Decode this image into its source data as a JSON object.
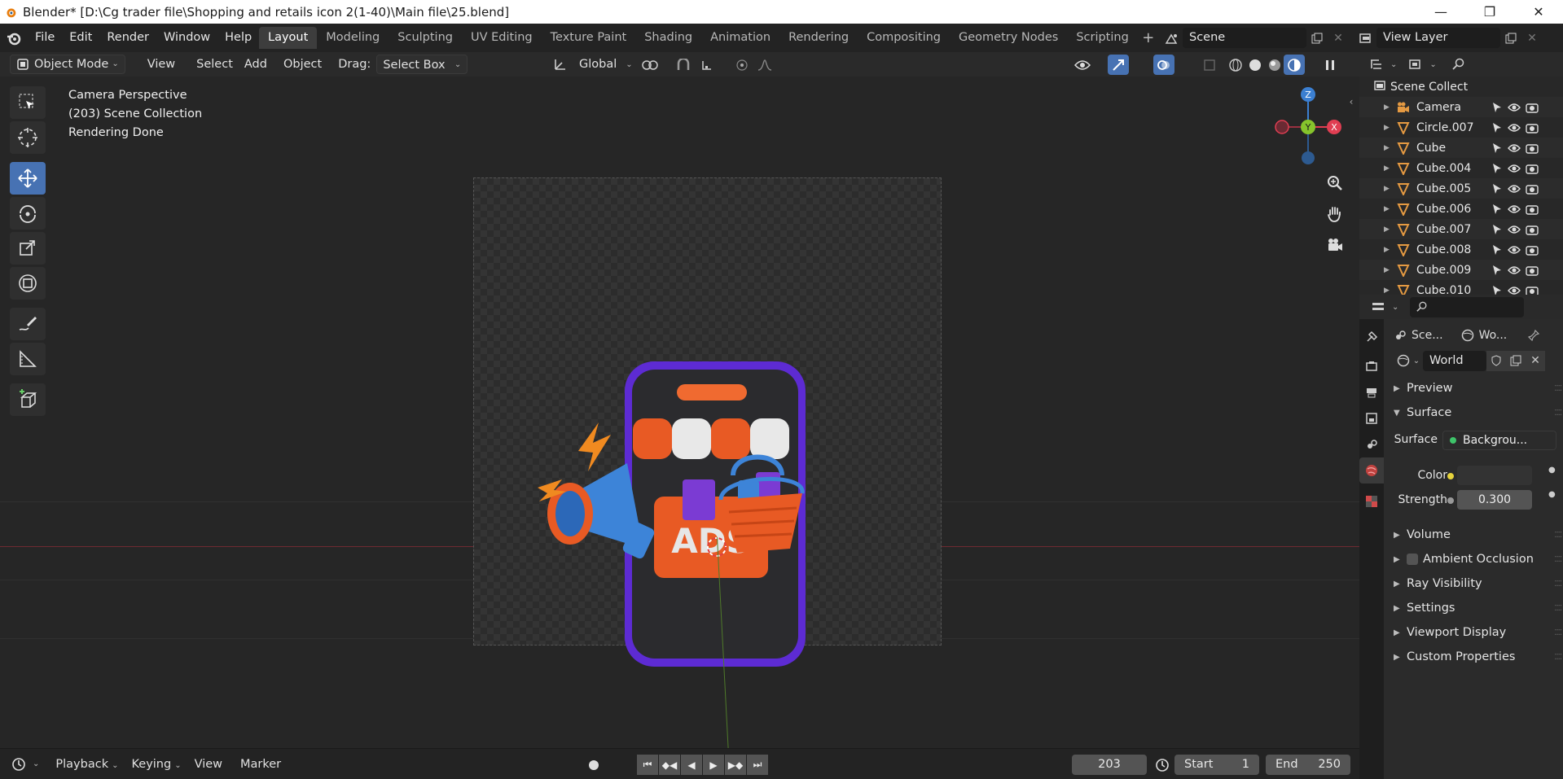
{
  "window": {
    "title": "Blender* [D:\\Cg trader file\\Shopping and retails icon 2(1-40)\\Main file\\25.blend]",
    "minimize": "—",
    "maximize": "❐",
    "close": "✕"
  },
  "menu": {
    "items": [
      "File",
      "Edit",
      "Render",
      "Window",
      "Help"
    ]
  },
  "workspaces": {
    "tabs": [
      "Layout",
      "Modeling",
      "Sculpting",
      "UV Editing",
      "Texture Paint",
      "Shading",
      "Animation",
      "Rendering",
      "Compositing",
      "Geometry Nodes",
      "Scripting"
    ],
    "active": "Layout",
    "add": "+"
  },
  "scene": {
    "name": "Scene"
  },
  "view_layer": {
    "name": "View Layer"
  },
  "viewport_header": {
    "mode": "Object Mode",
    "view": "View",
    "select": "Select",
    "add": "Add",
    "object": "Object",
    "drag_label": "Drag:",
    "drag_value": "Select Box",
    "transform_orientation": "Global"
  },
  "viewport_info": {
    "line1": "Camera Perspective",
    "line2": "(203) Scene Collection",
    "line3": "Rendering Done"
  },
  "gizmo": {
    "z": "Z",
    "y": "Y",
    "x": "X"
  },
  "render_text": {
    "ads": "ADS"
  },
  "outliner": {
    "root": "Scene Collect",
    "items": [
      {
        "name": "Camera",
        "type": "camera"
      },
      {
        "name": "Circle.007",
        "type": "mesh"
      },
      {
        "name": "Cube",
        "type": "mesh"
      },
      {
        "name": "Cube.004",
        "type": "mesh"
      },
      {
        "name": "Cube.005",
        "type": "mesh"
      },
      {
        "name": "Cube.006",
        "type": "mesh"
      },
      {
        "name": "Cube.007",
        "type": "mesh"
      },
      {
        "name": "Cube.008",
        "type": "mesh"
      },
      {
        "name": "Cube.009",
        "type": "mesh"
      },
      {
        "name": "Cube.010",
        "type": "mesh"
      }
    ]
  },
  "properties": {
    "path_scene": "Sce...",
    "path_world": "Wo...",
    "world_name": "World",
    "panels": {
      "preview": "Preview",
      "surface": "Surface",
      "volume": "Volume",
      "ambient_occlusion": "Ambient Occlusion",
      "ray_visibility": "Ray Visibility",
      "settings": "Settings",
      "viewport_display": "Viewport Display",
      "custom_properties": "Custom Properties"
    },
    "surface_label": "Surface",
    "surface_value": "Backgrou...",
    "color_label": "Color",
    "strength_label": "Strength",
    "strength_value": "0.300"
  },
  "timeline": {
    "playback": "Playback",
    "keying": "Keying",
    "view": "View",
    "marker": "Marker",
    "current_frame": "203",
    "start_label": "Start",
    "start_value": "1",
    "end_label": "End",
    "end_value": "250"
  },
  "colors": {
    "accent": "#4772b3",
    "x_axis": "#e03e52",
    "y_axis": "#86c42c",
    "z_axis": "#3b7fd1",
    "mesh_icon": "#e59a42"
  }
}
